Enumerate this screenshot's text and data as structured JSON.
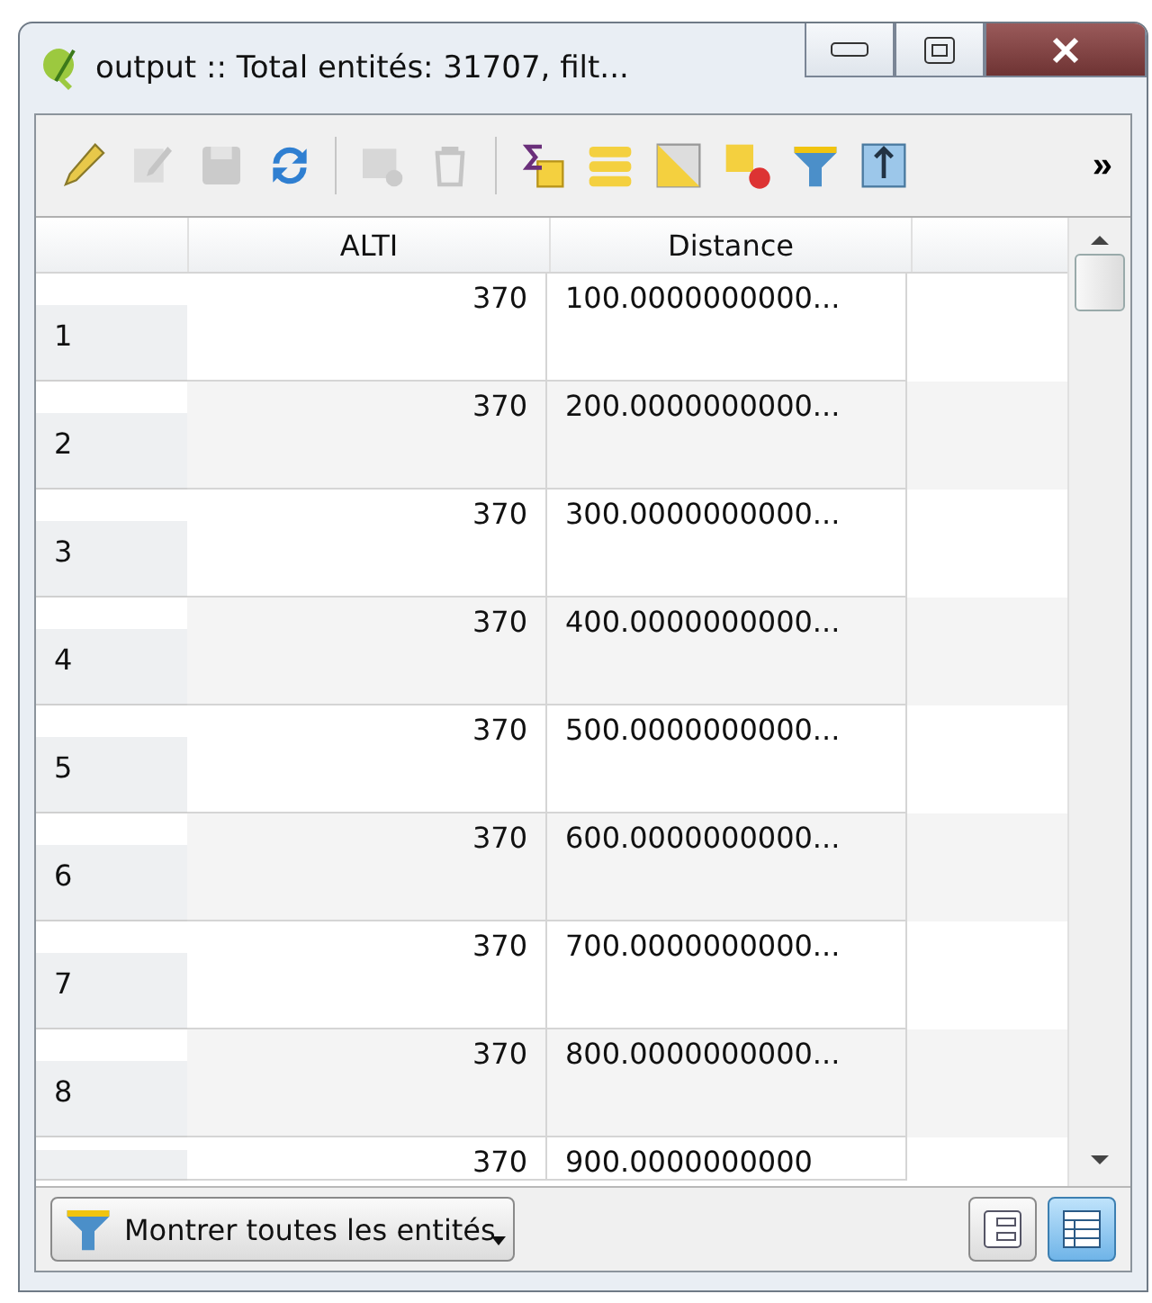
{
  "window": {
    "title": "output :: Total entités: 31707, filt..."
  },
  "toolbar": {
    "tools": [
      {
        "kind": "pencil",
        "disabled": false
      },
      {
        "kind": "edit",
        "disabled": true
      },
      {
        "kind": "save",
        "disabled": true
      },
      {
        "kind": "reload",
        "disabled": false
      },
      {
        "kind": "separator"
      },
      {
        "kind": "addrow",
        "disabled": true
      },
      {
        "kind": "trash",
        "disabled": true
      },
      {
        "kind": "separator"
      },
      {
        "kind": "expression",
        "disabled": false
      },
      {
        "kind": "selectall",
        "disabled": false
      },
      {
        "kind": "invert",
        "disabled": false
      },
      {
        "kind": "deselect",
        "disabled": false
      },
      {
        "kind": "filter",
        "disabled": false
      },
      {
        "kind": "movetop",
        "disabled": false
      }
    ],
    "overflow": "»"
  },
  "table": {
    "columns": [
      "ALTI",
      "Distance"
    ],
    "rows": [
      {
        "header": "1",
        "cells": [
          "370",
          "100.0000000000..."
        ]
      },
      {
        "header": "2",
        "cells": [
          "370",
          "200.0000000000..."
        ]
      },
      {
        "header": "3",
        "cells": [
          "370",
          "300.0000000000..."
        ]
      },
      {
        "header": "4",
        "cells": [
          "370",
          "400.0000000000..."
        ]
      },
      {
        "header": "5",
        "cells": [
          "370",
          "500.0000000000..."
        ]
      },
      {
        "header": "6",
        "cells": [
          "370",
          "600.0000000000..."
        ]
      },
      {
        "header": "7",
        "cells": [
          "370",
          "700.0000000000..."
        ]
      },
      {
        "header": "8",
        "cells": [
          "370",
          "800.0000000000..."
        ]
      },
      {
        "cells": [
          "370",
          "900.0000000000"
        ]
      }
    ]
  },
  "footer": {
    "filter_button": "Montrer toutes les entités",
    "views": [
      {
        "kind": "form",
        "selected": false
      },
      {
        "kind": "table",
        "selected": true
      }
    ]
  }
}
